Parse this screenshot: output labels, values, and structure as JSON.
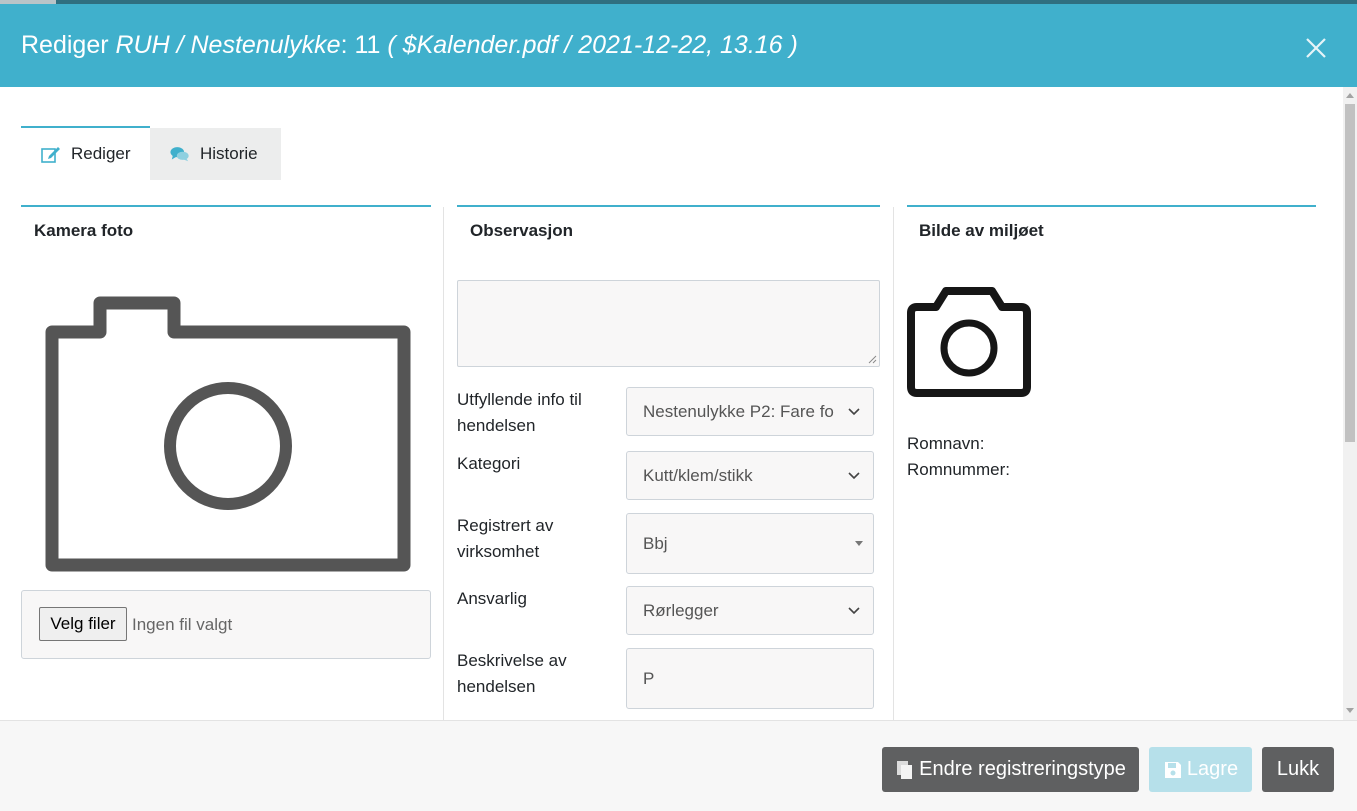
{
  "header": {
    "title_prefix": "Rediger ",
    "title_type": "RUH / Nestenulykke",
    "title_sep": ": ",
    "title_number": "11",
    "title_space": " ",
    "title_source": "( $Kalender.pdf / 2021-12-22, 13.16 )",
    "close_icon": "close-icon"
  },
  "tabs": [
    {
      "label": "Rediger",
      "icon": "edit-icon",
      "active": true
    },
    {
      "label": "Historie",
      "icon": "comments-icon",
      "active": false
    }
  ],
  "left_panel": {
    "title": "Kamera foto",
    "file_button": "Velg filer",
    "file_status": "Ingen fil valgt"
  },
  "middle_panel": {
    "title": "Observasjon",
    "observation_value": "",
    "fields": [
      {
        "label": "Utfyllende info til hendelsen",
        "value": "Nestenulykke P2: Fare fo",
        "control": "select"
      },
      {
        "label": "Kategori",
        "value": "Kutt/klem/stikk",
        "control": "select"
      },
      {
        "label": "Registrert av virksomhet",
        "value": "Bbj",
        "control": "select2"
      },
      {
        "label": "Ansvarlig",
        "value": "Rørlegger",
        "control": "select"
      },
      {
        "label": "Beskrivelse av hendelsen",
        "value": "P",
        "control": "input"
      }
    ]
  },
  "right_panel": {
    "title": "Bilde av miljøet",
    "room_name_label": "Romnavn:",
    "room_number_label": "Romnummer:"
  },
  "footer": {
    "change_type_label": "Endre registreringstype",
    "save_label": "Lagre",
    "close_label": "Lukk"
  },
  "colors": {
    "header": "#40b0cc",
    "accent": "#40b0cc",
    "button_gray": "#5f6061",
    "button_disabled": "#b6e0ea"
  }
}
